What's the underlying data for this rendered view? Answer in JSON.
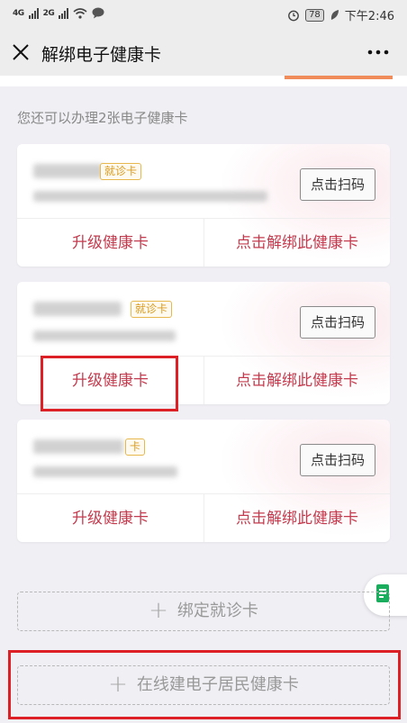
{
  "status_bar": {
    "signal_1": "4G",
    "signal_2": "2G",
    "battery": "78",
    "time": "下午2:46",
    "icons": [
      "alarm-icon",
      "leaf-icon",
      "wifi-icon",
      "chat-icon"
    ]
  },
  "header": {
    "title": "解绑电子健康卡",
    "close_icon": "close-icon",
    "more_icon": "more-icon"
  },
  "hint": "您还可以办理2张电子健康卡",
  "cards": [
    {
      "badge": "就诊卡",
      "scan_label": "点击扫码",
      "upgrade_label": "升级健康卡",
      "unbind_label": "点击解绑此健康卡"
    },
    {
      "badge": "就诊卡",
      "scan_label": "点击扫码",
      "upgrade_label": "升级健康卡",
      "unbind_label": "点击解绑此健康卡"
    },
    {
      "badge": "卡",
      "scan_label": "点击扫码",
      "upgrade_label": "升级健康卡",
      "unbind_label": "点击解绑此健康卡"
    }
  ],
  "bind_card_label": "绑定就诊卡",
  "create_card_label": "在线建电子居民健康卡",
  "colors": {
    "accent_red": "#c33b4e",
    "badge_gold": "#d99a1c",
    "highlight_red": "#dd1f26",
    "float_icon_green": "#1aad5e"
  }
}
